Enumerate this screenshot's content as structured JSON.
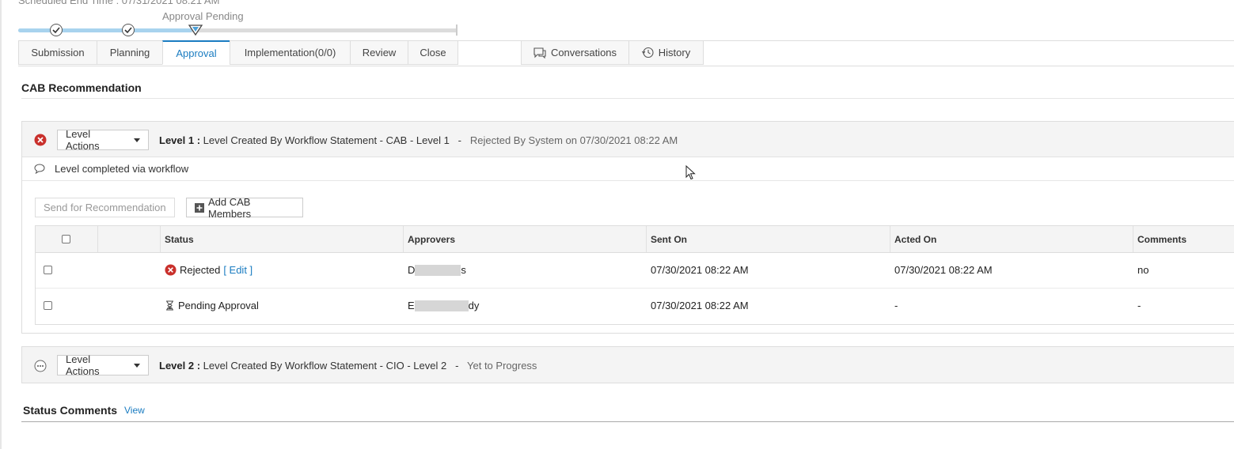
{
  "header": {
    "scheduled_end": "Scheduled End Time : 07/31/2021 08:21 AM",
    "stage_label": "Approval Pending"
  },
  "tabs": [
    {
      "label": "Submission"
    },
    {
      "label": "Planning"
    },
    {
      "label": "Approval",
      "active": true
    },
    {
      "label": "Implementation(0/0)"
    },
    {
      "label": "Review"
    },
    {
      "label": "Close"
    }
  ],
  "extra_tabs": [
    {
      "label": "Conversations",
      "icon": "chat-icon"
    },
    {
      "label": "History",
      "icon": "history-icon"
    }
  ],
  "cab": {
    "title": "CAB Recommendation"
  },
  "level1": {
    "actions_label": "Level Actions",
    "level": "Level  1 :",
    "name": "Level Created By Workflow Statement - CAB - Level 1",
    "sep": "-",
    "status": "Rejected By System on 07/30/2021 08:22 AM",
    "note": "Level completed via workflow",
    "send_label": "Send for Recommendation",
    "add_label": "Add CAB Members",
    "columns": [
      "Status",
      "Approvers",
      "Sent On",
      "Acted On",
      "Comments"
    ],
    "rows": [
      {
        "status": "Rejected",
        "edit": "[ Edit ]",
        "approver_start": "D",
        "approver_end": "s",
        "sent_on": "07/30/2021 08:22 AM",
        "acted_on": "07/30/2021 08:22 AM",
        "comments": "no"
      },
      {
        "status": "Pending Approval",
        "approver_start": "E",
        "approver_end": "dy",
        "sent_on": "07/30/2021 08:22 AM",
        "acted_on": "-",
        "comments": "-"
      }
    ]
  },
  "level2": {
    "actions_label": "Level Actions",
    "level": "Level  2 :",
    "name": "Level Created By Workflow Statement - CIO - Level 2",
    "sep": "-",
    "status": "Yet to Progress"
  },
  "status_comments": {
    "title": "Status Comments",
    "view": "View"
  },
  "colors": {
    "accent": "#1a7cc1",
    "reject": "#c9302c"
  }
}
